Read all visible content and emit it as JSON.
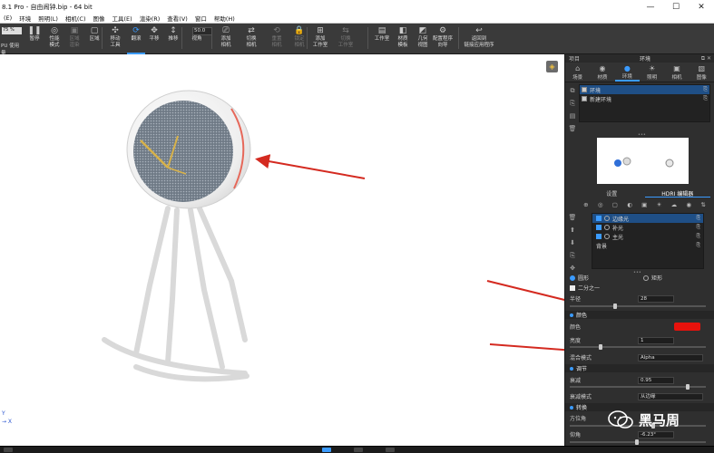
{
  "window": {
    "title": "8.1 Pro  -  自由闹钟.bip  -  64 bit",
    "minimize": "—",
    "maximize": "☐",
    "close": "✕"
  },
  "menu": [
    "(E)",
    "环境",
    "照明(L)",
    "相机(C)",
    "图像",
    "工具(E)",
    "渲染(R)",
    "查看(V)",
    "窗口",
    "帮助(H)"
  ],
  "toolbar": {
    "combo_value": "75 %",
    "left_label": "PU 使用量",
    "zoom_value": "50.0",
    "tools": [
      {
        "id": "pause",
        "icon": "❚❚",
        "label": "暂停",
        "state": "normal"
      },
      {
        "id": "perf",
        "icon": "◎",
        "label": "性能\n模式",
        "state": "normal"
      },
      {
        "id": "region-cpu",
        "icon": "▣",
        "label": "区域\n渲染",
        "state": "dim"
      },
      {
        "id": "region",
        "icon": "▢",
        "label": "区域",
        "state": "normal"
      },
      {
        "id": "move",
        "icon": "✣",
        "label": "移动\n工具",
        "state": "normal"
      },
      {
        "id": "tumble",
        "icon": "⟳",
        "label": "翻滚",
        "state": "active"
      },
      {
        "id": "pan",
        "icon": "✥",
        "label": "平移",
        "state": "normal"
      },
      {
        "id": "push",
        "icon": "↕",
        "label": "推移",
        "state": "normal"
      },
      {
        "id": "view",
        "icon": "◫",
        "label": "视角",
        "state": "normal"
      },
      {
        "id": "add-camera",
        "icon": "⎚",
        "label": "添加\n相机",
        "state": "normal"
      },
      {
        "id": "switch-camera",
        "icon": "⇄",
        "label": "切换\n相机",
        "state": "normal"
      },
      {
        "id": "reset-camera",
        "icon": "⟲",
        "label": "重置\n相机",
        "state": "dim"
      },
      {
        "id": "lock-camera",
        "icon": "🔒",
        "label": "锁定\n相机",
        "state": "dim"
      },
      {
        "id": "add-workspace",
        "icon": "⊞",
        "label": "添加\n工作室",
        "state": "normal"
      },
      {
        "id": "switch-workspace",
        "icon": "⇆",
        "label": "切换\n工作室",
        "state": "dim"
      },
      {
        "id": "studio",
        "icon": "▤",
        "label": "工作室",
        "state": "normal"
      },
      {
        "id": "material-template",
        "icon": "◧",
        "label": "材质\n模板",
        "state": "normal"
      },
      {
        "id": "geometry-view",
        "icon": "◩",
        "label": "几何\n视图",
        "state": "normal"
      },
      {
        "id": "config-wizard",
        "icon": "⚙",
        "label": "配置程序\n向导",
        "state": "normal"
      },
      {
        "id": "back-to-app",
        "icon": "↩",
        "label": "返回到\n链接应用程序",
        "state": "normal"
      }
    ]
  },
  "viewport": {
    "axis_y": "Y",
    "axis_x": "→ X",
    "arrow_color": "#d42a20"
  },
  "panel": {
    "left_label": "项目",
    "title": "环境",
    "right_controls": "⧉ ✕",
    "tabs": [
      {
        "icon": "⌂",
        "label": "场景"
      },
      {
        "icon": "◉",
        "label": "材质"
      },
      {
        "icon": "●",
        "label": "环境",
        "active": true
      },
      {
        "icon": "☀",
        "label": "照明"
      },
      {
        "icon": "▣",
        "label": "相机"
      },
      {
        "icon": "▧",
        "label": "图像"
      }
    ],
    "environments": [
      {
        "name": "环境",
        "selected": true,
        "icon": "⎘"
      },
      {
        "name": "新建环境",
        "selected": false,
        "icon": "⎘"
      }
    ],
    "expander": "•••",
    "subtabs": [
      "设置",
      "HDRI 编辑器"
    ],
    "lights": [
      {
        "name": "边缘光",
        "selected": true
      },
      {
        "name": "补光",
        "selected": false
      },
      {
        "name": "主光",
        "selected": false
      },
      {
        "name": "背景",
        "selected": false,
        "background": true
      }
    ],
    "shape": {
      "circle": "圆形",
      "rect": "矩形"
    },
    "half": "二分之一",
    "radius_label": "半径",
    "radius_value": "28",
    "color_section": "颜色",
    "color_label": "颜色",
    "color_value": "#e8120c",
    "brightness_label": "亮度",
    "brightness_value": "1",
    "blend_label": "混合模式",
    "blend_value": "Alpha",
    "adjust_section": "调节",
    "falloff_label": "衰减",
    "falloff_value": "0.95",
    "falloff_mode_label": "衰减模式",
    "falloff_mode_value": "从边缘",
    "transform_section": "转换",
    "azimuth_label": "方位角",
    "elevation_label": "仰角",
    "elevation_value": "-6.23°"
  },
  "watermark": "黑马周"
}
